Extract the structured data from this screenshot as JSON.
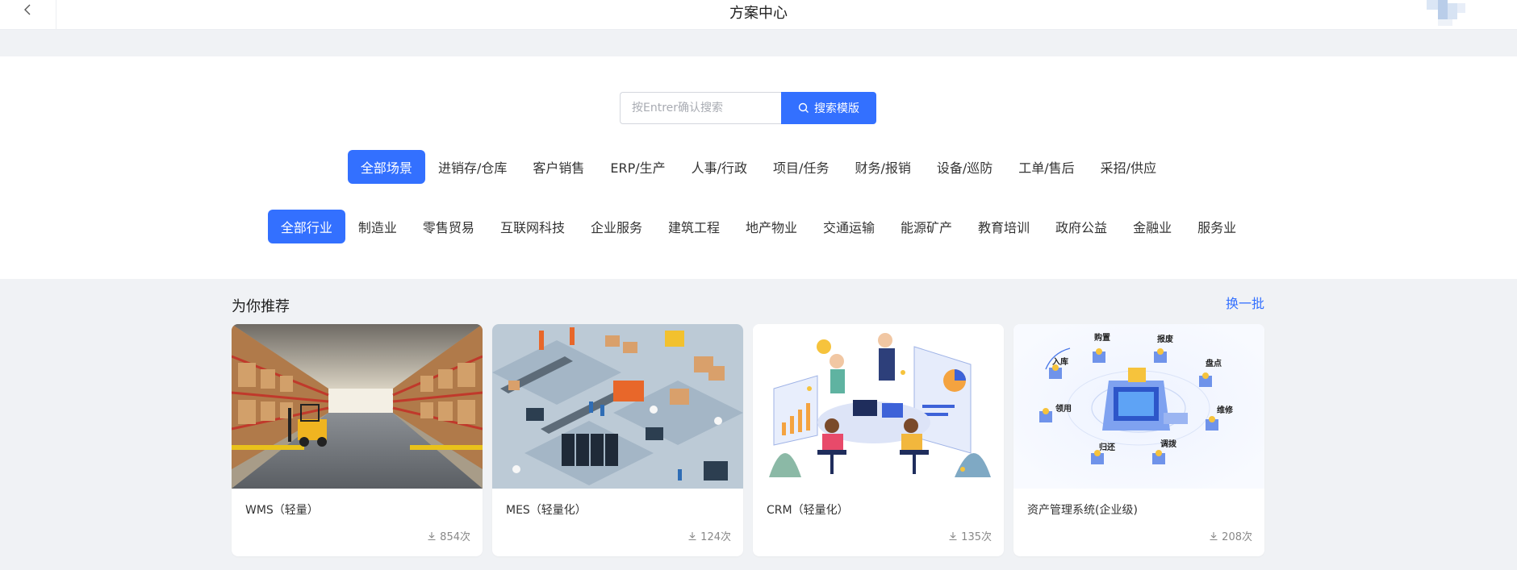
{
  "header": {
    "title": "方案中心"
  },
  "search": {
    "placeholder": "按Entrer确认搜索",
    "button_label": "搜索模版"
  },
  "scenes": [
    {
      "label": "全部场景",
      "active": true
    },
    {
      "label": "进销存/仓库",
      "active": false
    },
    {
      "label": "客户销售",
      "active": false
    },
    {
      "label": "ERP/生产",
      "active": false
    },
    {
      "label": "人事/行政",
      "active": false
    },
    {
      "label": "项目/任务",
      "active": false
    },
    {
      "label": "财务/报销",
      "active": false
    },
    {
      "label": "设备/巡防",
      "active": false
    },
    {
      "label": "工单/售后",
      "active": false
    },
    {
      "label": "采招/供应",
      "active": false
    }
  ],
  "industries": [
    {
      "label": "全部行业",
      "active": true
    },
    {
      "label": "制造业",
      "active": false
    },
    {
      "label": "零售贸易",
      "active": false
    },
    {
      "label": "互联网科技",
      "active": false
    },
    {
      "label": "企业服务",
      "active": false
    },
    {
      "label": "建筑工程",
      "active": false
    },
    {
      "label": "地产物业",
      "active": false
    },
    {
      "label": "交通运输",
      "active": false
    },
    {
      "label": "能源矿产",
      "active": false
    },
    {
      "label": "教育培训",
      "active": false
    },
    {
      "label": "政府公益",
      "active": false
    },
    {
      "label": "金融业",
      "active": false
    },
    {
      "label": "服务业",
      "active": false
    }
  ],
  "recommend": {
    "title": "为你推荐",
    "refresh_label": "换一批",
    "cards": [
      {
        "name": "WMS（轻量）",
        "count": "854次",
        "image": "warehouse-image"
      },
      {
        "name": "MES（轻量化）",
        "count": "124次",
        "image": "factory-image"
      },
      {
        "name": "CRM（轻量化）",
        "count": "135次",
        "image": "meeting-image"
      },
      {
        "name": "资产管理系统(企业级)",
        "count": "208次",
        "image": "asset-diagram-image",
        "diagram_labels": [
          "入库",
          "购置",
          "报废",
          "盘点",
          "领用",
          "维修",
          "归还",
          "调拨"
        ]
      }
    ]
  },
  "colors": {
    "accent": "#3370ff",
    "page_bg": "#f0f2f5"
  }
}
